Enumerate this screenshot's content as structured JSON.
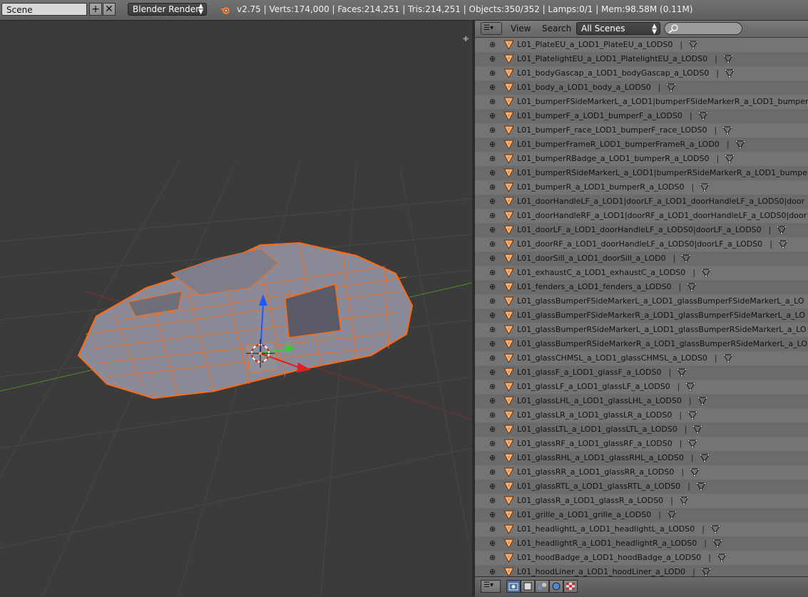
{
  "header": {
    "scene_name": "Scene",
    "add_icon": "plus-icon",
    "close_icon": "x-icon",
    "render_engine": "Blender Render",
    "stats": "v2.75 | Verts:174,000 | Faces:214,251 | Tris:214,251 | Objects:350/352 | Lamps:0/1 | Mem:98.58M (0.11M)"
  },
  "viewport": {
    "wire_color": "#ff6a10",
    "mesh_color": "#8a8a98",
    "grid_color": "#4b4b4b",
    "axis_x_color": "#9a2b2b",
    "axis_y_color": "#4d8a2b"
  },
  "outliner": {
    "menu_view": "View",
    "menu_search": "Search",
    "filter_select": "All Scenes",
    "search_placeholder": "",
    "rows": [
      {
        "name": "L01_PlateEU_a_LOD1_PlateEU_a_LODS0"
      },
      {
        "name": "L01_PlatelightEU_a_LOD1_PlatelightEU_a_LODS0"
      },
      {
        "name": "L01_bodyGascap_a_LOD1_bodyGascap_a_LODS0"
      },
      {
        "name": "L01_body_a_LOD1_body_a_LODS0"
      },
      {
        "name": "L01_bumperFSideMarkerL_a_LOD1|bumperFSideMarkerR_a_LOD1_bumperF"
      },
      {
        "name": "L01_bumperF_a_LOD1_bumperF_a_LODS0"
      },
      {
        "name": "L01_bumperF_race_LOD1_bumperF_race_LODS0"
      },
      {
        "name": "L01_bumperFrameR_LOD1_bumperFrameR_a_LOD0"
      },
      {
        "name": "L01_bumperRBadge_a_LOD1_bumperR_a_LODS0"
      },
      {
        "name": "L01_bumperRSideMarkerL_a_LOD1|bumperRSideMarkerR_a_LOD1_bumperR"
      },
      {
        "name": "L01_bumperR_a_LOD1_bumperR_a_LODS0"
      },
      {
        "name": "L01_doorHandleLF_a_LOD1|doorLF_a_LOD1_doorHandleLF_a_LODS0|door"
      },
      {
        "name": "L01_doorHandleRF_a_LOD1|doorRF_a_LOD1_doorHandleLF_a_LODS0|door"
      },
      {
        "name": "L01_doorLF_a_LOD1_doorHandleLF_a_LODS0|doorLF_a_LODS0"
      },
      {
        "name": "L01_doorRF_a_LOD1_doorHandleLF_a_LODS0|doorLF_a_LODS0"
      },
      {
        "name": "L01_doorSill_a_LOD1_doorSill_a_LOD0"
      },
      {
        "name": "L01_exhaustC_a_LOD1_exhaustC_a_LODS0"
      },
      {
        "name": "L01_fenders_a_LOD1_fenders_a_LODS0"
      },
      {
        "name": "L01_glassBumperFSideMarkerL_a_LOD1_glassBumperFSideMarkerL_a_LO"
      },
      {
        "name": "L01_glassBumperFSideMarkerR_a_LOD1_glassBumperFSideMarkerL_a_LO"
      },
      {
        "name": "L01_glassBumperRSideMarkerL_a_LOD1_glassBumperRSideMarkerL_a_LO"
      },
      {
        "name": "L01_glassBumperRSideMarkerR_a_LOD1_glassBumperRSideMarkerL_a_LO"
      },
      {
        "name": "L01_glassCHMSL_a_LOD1_glassCHMSL_a_LODS0"
      },
      {
        "name": "L01_glassF_a_LOD1_glassF_a_LODS0"
      },
      {
        "name": "L01_glassLF_a_LOD1_glassLF_a_LODS0"
      },
      {
        "name": "L01_glassLHL_a_LOD1_glassLHL_a_LODS0"
      },
      {
        "name": "L01_glassLR_a_LOD1_glassLR_a_LODS0"
      },
      {
        "name": "L01_glassLTL_a_LOD1_glassLTL_a_LODS0"
      },
      {
        "name": "L01_glassRF_a_LOD1_glassRF_a_LODS0"
      },
      {
        "name": "L01_glassRHL_a_LOD1_glassRHL_a_LODS0"
      },
      {
        "name": "L01_glassRR_a_LOD1_glassRR_a_LODS0"
      },
      {
        "name": "L01_glassRTL_a_LOD1_glassRTL_a_LODS0"
      },
      {
        "name": "L01_glassR_a_LOD1_glassR_a_LODS0"
      },
      {
        "name": "L01_grille_a_LOD1_grille_a_LODS0"
      },
      {
        "name": "L01_headlightL_a_LOD1_headlightL_a_LODS0"
      },
      {
        "name": "L01_headlightR_a_LOD1_headlightR_a_LODS0"
      },
      {
        "name": "L01_hoodBadge_a_LOD1_hoodBadge_a_LODS0"
      },
      {
        "name": "L01_hoodLiner_a_LOD1_hoodLiner_a_LOD0"
      }
    ],
    "bottom_buttons": [
      "editor-type-icon",
      "render-layers-icon",
      "outliner-icon",
      "node-icon",
      "world-icon",
      "texture-icon"
    ]
  }
}
